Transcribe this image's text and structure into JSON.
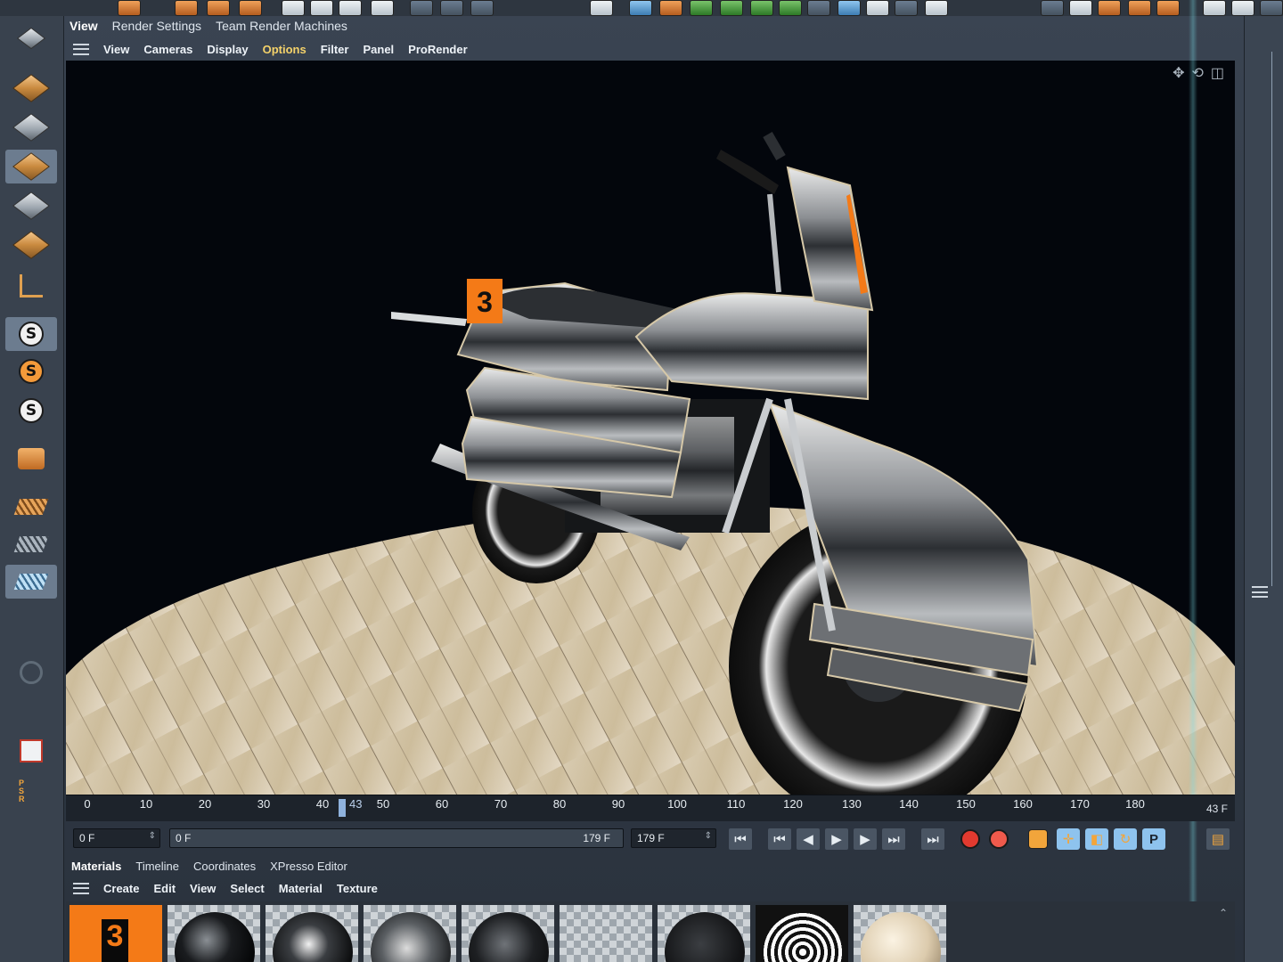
{
  "viewport_tabs": [
    {
      "label": "View",
      "active": true
    },
    {
      "label": "Render Settings",
      "active": false
    },
    {
      "label": "Team Render Machines",
      "active": false
    }
  ],
  "viewport_menu": [
    {
      "label": "View"
    },
    {
      "label": "Cameras"
    },
    {
      "label": "Display"
    },
    {
      "label": "Options",
      "highlighted": true
    },
    {
      "label": "Filter"
    },
    {
      "label": "Panel"
    },
    {
      "label": "ProRender"
    }
  ],
  "left_tools": [
    {
      "icon": "cube-object-icon",
      "selected": false
    },
    {
      "icon": "checker-cube-icon",
      "selected": false
    },
    {
      "icon": "points-mode-icon",
      "selected": true
    },
    {
      "icon": "edges-mode-icon",
      "selected": false
    },
    {
      "icon": "polygons-mode-icon",
      "selected": false
    },
    {
      "icon": "axis-mode-icon",
      "selected": false
    },
    {
      "icon": "solo-off-icon",
      "letter": "S",
      "selected": true
    },
    {
      "icon": "solo-single-icon",
      "letter": "S",
      "selected": false
    },
    {
      "icon": "solo-hierarchy-icon",
      "letter": "S",
      "selected": false
    },
    {
      "icon": "snap-magnet-icon",
      "selected": false
    },
    {
      "icon": "workplane-icon",
      "selected": false
    },
    {
      "icon": "locked-workplane-icon",
      "selected": false
    },
    {
      "icon": "planar-workplane-icon",
      "selected": true
    }
  ],
  "timeline": {
    "ticks": [
      "0",
      "10",
      "20",
      "30",
      "40",
      "50",
      "60",
      "70",
      "80",
      "90",
      "100",
      "110",
      "120",
      "130",
      "140",
      "150",
      "160",
      "170",
      "180"
    ],
    "current_frame": "43",
    "frame_display": "43 F"
  },
  "transport": {
    "start_field": "0 F",
    "preview_min": "0 F",
    "preview_max": "179 F",
    "end_field": "179 F"
  },
  "materials": {
    "tabs": [
      {
        "label": "Materials",
        "active": true
      },
      {
        "label": "Timeline",
        "active": false
      },
      {
        "label": "Coordinates",
        "active": false
      },
      {
        "label": "XPresso Editor",
        "active": false
      }
    ],
    "menu": [
      "Create",
      "Edit",
      "View",
      "Select",
      "Material",
      "Texture"
    ],
    "swatches": [
      {
        "kind": "orange-decal",
        "badge": "3"
      },
      {
        "kind": "black-gloss"
      },
      {
        "kind": "black-chrome"
      },
      {
        "kind": "chrome"
      },
      {
        "kind": "dark-metal"
      },
      {
        "kind": "transparent"
      },
      {
        "kind": "black-rubber"
      },
      {
        "kind": "lamp-texture"
      },
      {
        "kind": "wood-sphere"
      }
    ]
  },
  "colors": {
    "accent_highlight": "#f4d26a",
    "ui_bg": "#3a4452",
    "viewport_bg": "#03060c",
    "record_red": "#e23a2f",
    "decal_orange": "#f47a17"
  }
}
